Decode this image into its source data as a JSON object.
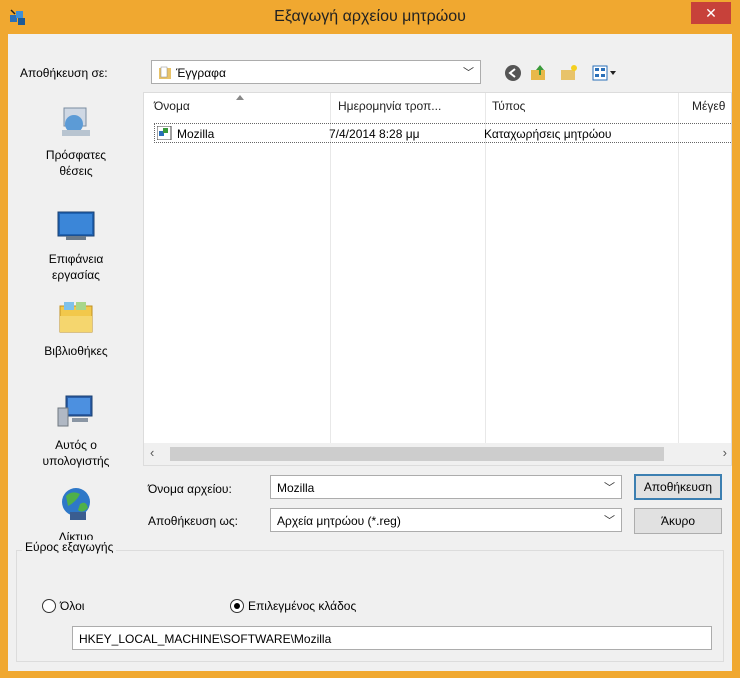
{
  "window": {
    "title": "Εξαγωγή αρχείου μητρώου",
    "close_glyph": "✕",
    "accent_color": "#f0a830"
  },
  "save_in": {
    "label": "Αποθήκευση σε:",
    "value": "Έγγραφα"
  },
  "toolbar": {
    "icons": [
      "back-icon",
      "up-folder-icon",
      "new-folder-icon",
      "view-menu-icon"
    ]
  },
  "places": [
    {
      "label_line1": "Πρόσφατες",
      "label_line2": "θέσεις",
      "icon": "recent-places-icon"
    },
    {
      "label_line1": "Επιφάνεια",
      "label_line2": "εργασίας",
      "icon": "desktop-icon"
    },
    {
      "label_line1": "Βιβλιοθήκες",
      "label_line2": "",
      "icon": "libraries-icon"
    },
    {
      "label_line1": "Αυτός ο",
      "label_line2": "υπολογιστής",
      "icon": "computer-icon"
    },
    {
      "label_line1": "Δίκτυο",
      "label_line2": "",
      "icon": "network-icon"
    }
  ],
  "file_list": {
    "columns": [
      "Όνομα",
      "Ημερομηνία τροπ...",
      "Τύπος",
      "Μέγεθ"
    ],
    "rows": [
      {
        "name": "Mozilla",
        "date": "7/4/2014 8:28 μμ",
        "type": "Καταχωρήσεις μητρώου",
        "size": ""
      }
    ]
  },
  "file_name": {
    "label": "Όνομα αρχείου:",
    "value": "Mozilla"
  },
  "save_as": {
    "label": "Αποθήκευση ως:",
    "value": "Αρχεία μητρώου (*.reg)"
  },
  "buttons": {
    "save": "Αποθήκευση",
    "cancel": "Άκυρο"
  },
  "export_range": {
    "title": "Εύρος εξαγωγής",
    "option_all": "Όλοι",
    "option_branch": "Επιλεγμένος κλάδος",
    "selected": "branch",
    "path": "HKEY_LOCAL_MACHINE\\SOFTWARE\\Mozilla"
  }
}
